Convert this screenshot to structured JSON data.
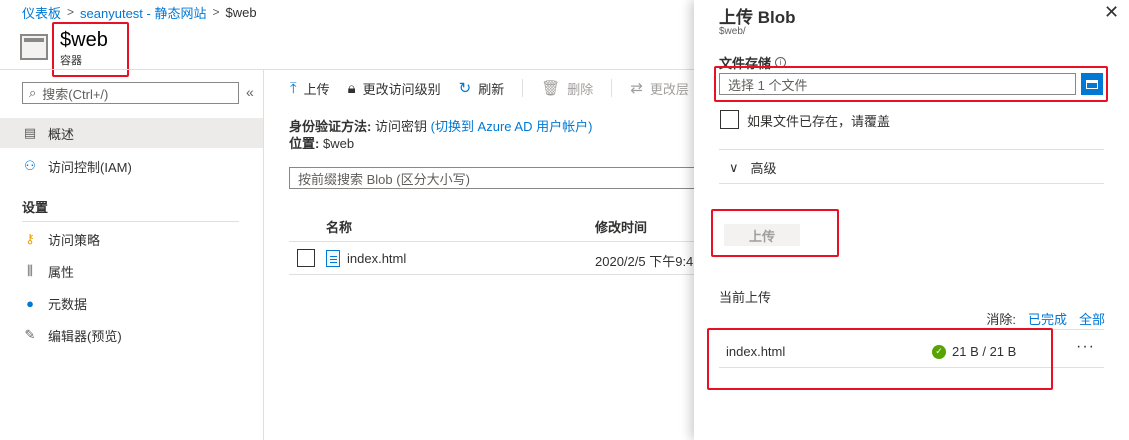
{
  "breadcrumb": {
    "home": "仪表板",
    "account": "seanyutest - 静态网站",
    "current": "$web"
  },
  "resource": {
    "title": "$web",
    "subtitle": "容器"
  },
  "sidebar": {
    "search_placeholder": "搜索(Ctrl+/)",
    "collapse": "«",
    "items": [
      {
        "label": "概述",
        "icon": "overview-icon"
      },
      {
        "label": "访问控制(IAM)",
        "icon": "people-icon"
      }
    ],
    "settings_heading": "设置",
    "settings_items": [
      {
        "label": "访问策略",
        "icon": "key-icon"
      },
      {
        "label": "属性",
        "icon": "properties-icon"
      },
      {
        "label": "元数据",
        "icon": "info-icon"
      },
      {
        "label": "编辑器(预览)",
        "icon": "pencil-icon"
      }
    ]
  },
  "toolbar": {
    "upload": "上传",
    "change_access": "更改访问级别",
    "refresh": "刷新",
    "delete": "删除",
    "change_tier": "更改层"
  },
  "info": {
    "auth_label": "身份验证方法:",
    "auth_value": "访问密钥",
    "auth_link": "(切换到 Azure AD 用户帐户)",
    "location_label": "位置:",
    "location_value": "$web"
  },
  "blob_search_placeholder": "按前缀搜索 Blob (区分大小写)",
  "table": {
    "headers": {
      "name": "名称",
      "modified": "修改时间"
    },
    "rows": [
      {
        "name": "index.html",
        "modified": "2020/2/5 下午9:4"
      }
    ]
  },
  "panel": {
    "title": "上传 Blob",
    "subtitle": "$web/",
    "close": "✕",
    "file_label": "文件存储",
    "file_placeholder": "选择 1 个文件",
    "overwrite_label": "如果文件已存在，请覆盖",
    "advanced": "高级",
    "upload_button": "上传",
    "current_uploads": "当前上传",
    "clear_label": "消除:",
    "clear_completed": "已完成",
    "clear_all": "全部",
    "upload_item": {
      "name": "index.html",
      "progress": "21 B / 21 B"
    },
    "more": "···"
  },
  "colors": {
    "accent": "#0078d4",
    "highlight": "#e81123",
    "success": "#57a300"
  }
}
